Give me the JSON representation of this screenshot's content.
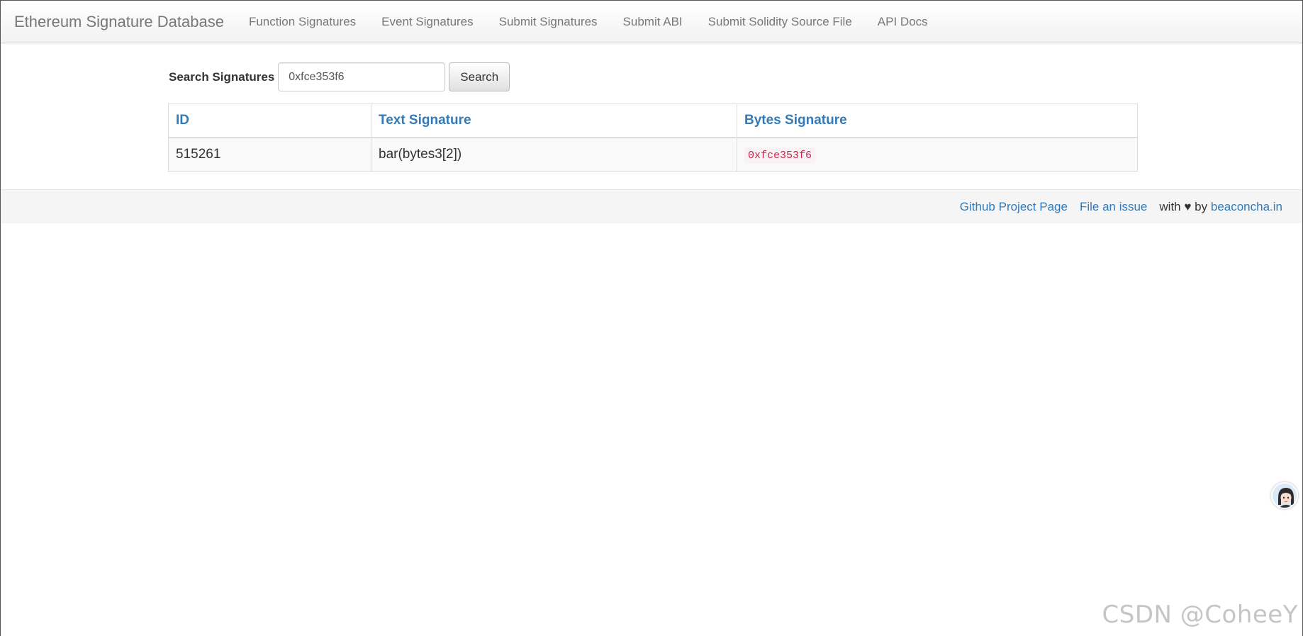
{
  "navbar": {
    "brand": "Ethereum Signature Database",
    "links": [
      {
        "label": "Function Signatures"
      },
      {
        "label": "Event Signatures"
      },
      {
        "label": "Submit Signatures"
      },
      {
        "label": "Submit ABI"
      },
      {
        "label": "Submit Solidity Source File"
      },
      {
        "label": "API Docs"
      }
    ]
  },
  "search": {
    "label": "Search Signatures",
    "value": "0xfce353f6",
    "button_label": "Search"
  },
  "table": {
    "headers": {
      "id": "ID",
      "text_signature": "Text Signature",
      "bytes_signature": "Bytes Signature"
    },
    "rows": [
      {
        "id": "515261",
        "text_signature": "bar(bytes3[2])",
        "bytes_signature": "0xfce353f6"
      }
    ]
  },
  "footer": {
    "github_link": "Github Project Page",
    "issue_link": "File an issue",
    "with_text": "with ♥ by",
    "by_link": "beaconcha.in"
  },
  "watermark": "CSDN @CoheeY",
  "colors": {
    "link": "#337ab7",
    "code_text": "#c7254e",
    "code_bg": "#f9f2f4"
  },
  "icons": {
    "avatar": "avatar-icon"
  }
}
